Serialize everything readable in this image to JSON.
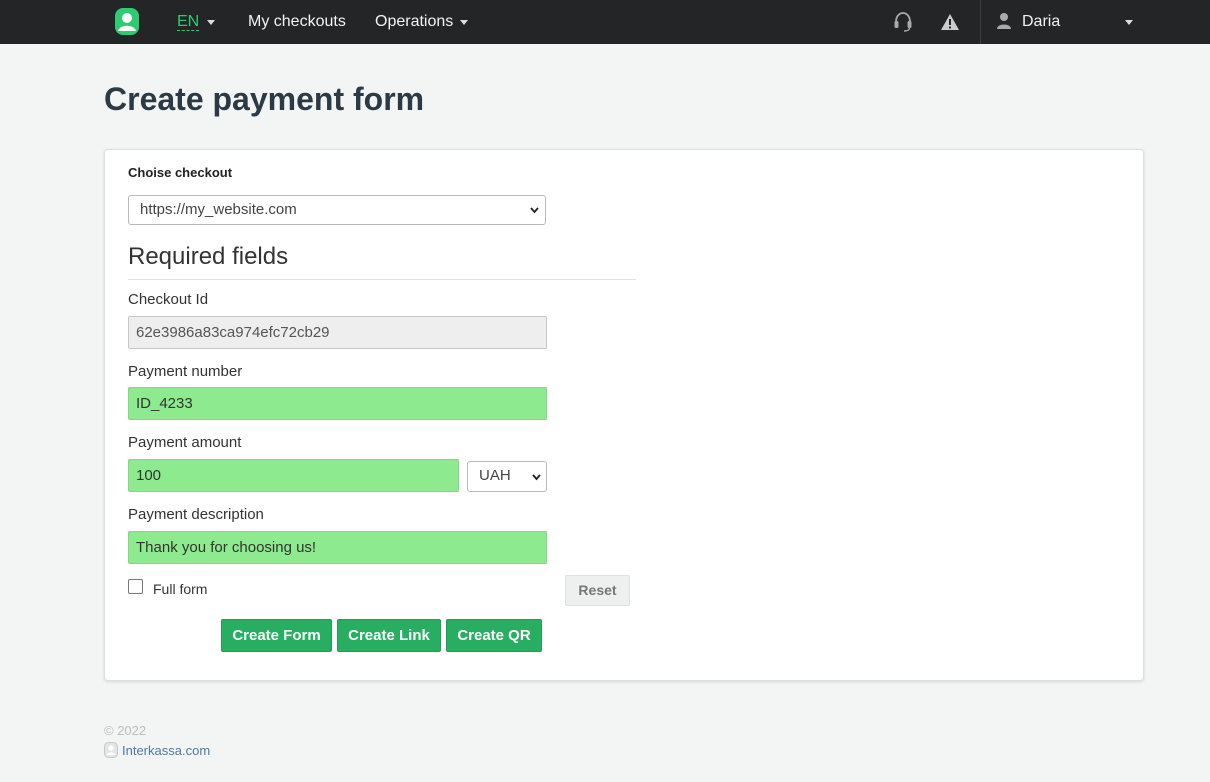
{
  "nav": {
    "logo_icon": "interkassa-logo-icon",
    "language": "EN",
    "my_checkouts": "My checkouts",
    "operations": "Operations",
    "support_icon": "headset-icon",
    "warning_icon": "warning-icon",
    "user_icon": "user-icon",
    "user_name": "Daria"
  },
  "page": {
    "title": "Create payment form"
  },
  "form": {
    "checkout_label": "Choise checkout",
    "checkout_selected": "https://my_website.com",
    "required_title": "Required fields",
    "checkout_id_label": "Checkout Id",
    "checkout_id_value": "62e3986a83ca974efc72cb29",
    "payment_number_label": "Payment number",
    "payment_number_value": "ID_4233",
    "payment_amount_label": "Payment amount",
    "payment_amount_value": "100",
    "currency_selected": "UAH",
    "payment_description_label": "Payment description",
    "payment_description_value": "Thank you for choosing us!",
    "full_form_label": "Full form",
    "full_form_checked": false,
    "reset_label": "Reset",
    "create_form_label": "Create Form",
    "create_link_label": "Create Link",
    "create_qr_label": "Create QR"
  },
  "colors": {
    "navbar_bg": "#232527",
    "accent_green": "#27ae60",
    "field_filled_bg": "#8eea8e",
    "language_green": "#2ecc71"
  },
  "footer": {
    "year": "© 2022",
    "site_link": "Interkassa.com"
  }
}
